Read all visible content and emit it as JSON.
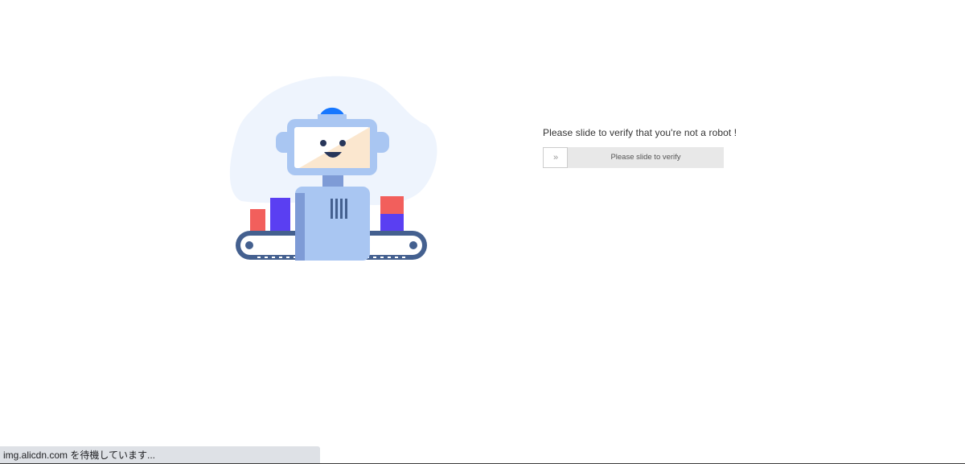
{
  "verify": {
    "prompt": "Please slide to verify that you're not a robot !",
    "slider_label": "Please slide to verify",
    "handle_glyph": "»"
  },
  "status_bar": {
    "text": "img.alicdn.com を待機しています..."
  },
  "illustration": {
    "name": "robot-conveyor-illustration"
  },
  "colors": {
    "accent_blue": "#1677ff",
    "robot_body": "#a9c6f2",
    "blob": "#eef4fd",
    "red_box": "#f25f5c",
    "purple_box": "#5a3ff2",
    "slider_track": "#e8e8e8"
  }
}
